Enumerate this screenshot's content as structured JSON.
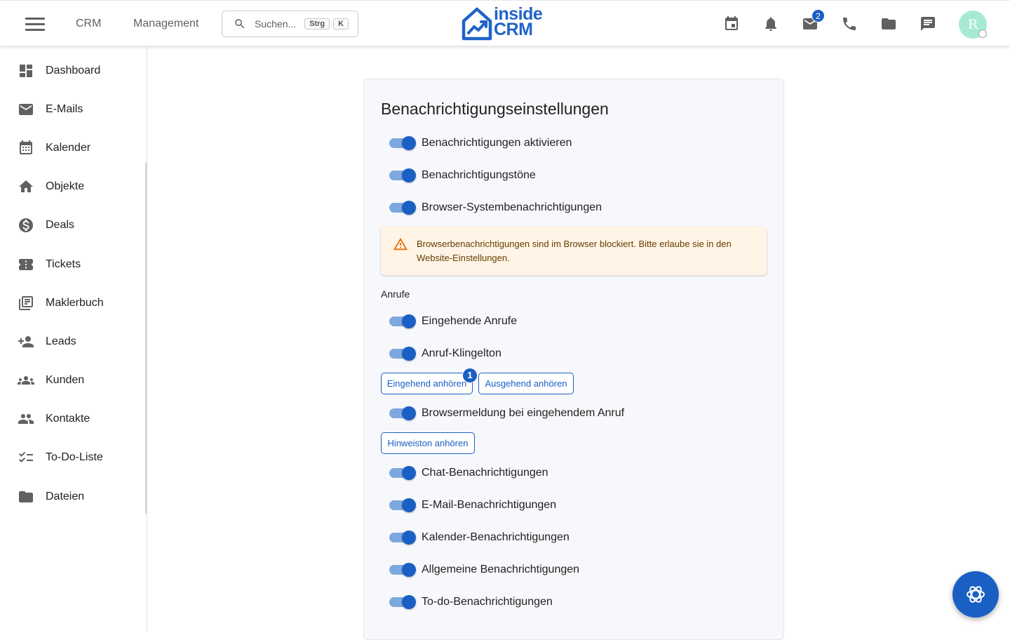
{
  "header": {
    "nav_links": [
      "CRM",
      "Management"
    ],
    "search": {
      "placeholder": "Suchen...",
      "shortcut_key1": "Strg",
      "shortcut_key2": "K"
    },
    "logo": {
      "line1": "inside",
      "line2": "CRM"
    },
    "mail_badge": "2",
    "avatar_initial": "R",
    "icons": [
      "calendar-icon",
      "bell-icon",
      "mail-icon",
      "phone-icon",
      "folder-icon",
      "chat-icon"
    ]
  },
  "sidebar": {
    "items": [
      {
        "label": "Dashboard",
        "icon": "dashboard-icon"
      },
      {
        "label": "E-Mails",
        "icon": "mail-icon"
      },
      {
        "label": "Kalender",
        "icon": "calendar-icon"
      },
      {
        "label": "Objekte",
        "icon": "home-icon"
      },
      {
        "label": "Deals",
        "icon": "dollar-icon"
      },
      {
        "label": "Tickets",
        "icon": "ticket-icon"
      },
      {
        "label": "Maklerbuch",
        "icon": "library-icon"
      },
      {
        "label": "Leads",
        "icon": "person-add-icon"
      },
      {
        "label": "Kunden",
        "icon": "groups-icon"
      },
      {
        "label": "Kontakte",
        "icon": "people-icon"
      },
      {
        "label": "To-Do-Liste",
        "icon": "checklist-icon"
      },
      {
        "label": "Dateien",
        "icon": "folder-icon"
      }
    ]
  },
  "settings": {
    "title": "Benachrichtigungseinstellungen",
    "toggles_top": [
      {
        "label": "Benachrichtigungen aktivieren",
        "checked": true
      },
      {
        "label": "Benachrichtigungstöne",
        "checked": true
      },
      {
        "label": "Browser-Systembenachrichtigungen",
        "checked": true
      }
    ],
    "alert": "Browserbenachrichtigungen sind im Browser blockiert. Bitte erlaube sie in den Website-Einstellungen.",
    "calls_section": "Anrufe",
    "calls_toggles": [
      {
        "label": "Eingehende Anrufe",
        "checked": true
      },
      {
        "label": "Anruf-Klingelton",
        "checked": true
      }
    ],
    "btn_incoming": "Eingehend anhören",
    "btn_incoming_badge": "1",
    "btn_outgoing": "Ausgehend anhören",
    "browser_call_toggle": {
      "label": "Browsermeldung bei eingehendem Anruf",
      "checked": true
    },
    "btn_hint": "Hinweiston anhören",
    "other_toggles": [
      {
        "label": "Chat-Benachrichtigungen",
        "checked": true
      },
      {
        "label": "E-Mail-Benachrichtigungen",
        "checked": true
      },
      {
        "label": "Kalender-Benachrichtigungen",
        "checked": true
      },
      {
        "label": "Allgemeine Benachrichtigungen",
        "checked": true
      },
      {
        "label": "To-do-Benachrichtigungen",
        "checked": true
      }
    ]
  },
  "colors": {
    "primary": "#1a5fc4",
    "switch_track": "#7da8df",
    "alert_bg": "#fff4e5",
    "alert_icon": "#ed6c02"
  }
}
